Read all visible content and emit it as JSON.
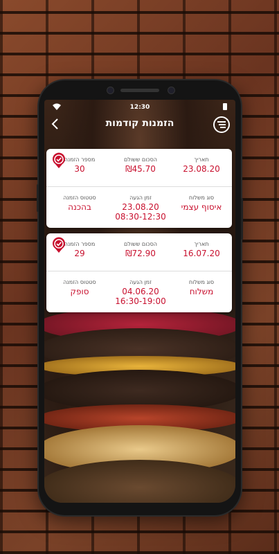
{
  "status_bar": {
    "time": "12:30"
  },
  "header": {
    "title": "הזמנות קודמות"
  },
  "labels": {
    "date": "תאריך",
    "total_paid": "הסכום ששולם",
    "order_number": "מספר הזמנה",
    "delivery_type": "סוג משלוח",
    "arrival_time": "זמן הגעה",
    "order_status": "סטטוס הזמנה"
  },
  "orders": [
    {
      "date": "23.08.20",
      "total": "₪45.70",
      "order_number": "30",
      "delivery_type": "איסוף עצמי",
      "arrival_date": "23.08.20",
      "arrival_window": "08:30-12:30",
      "status": "בהכנה"
    },
    {
      "date": "16.07.20",
      "total": "₪72.90",
      "order_number": "29",
      "delivery_type": "משלוח",
      "arrival_date": "04.06.20",
      "arrival_window": "16:30-19:00",
      "status": "סופק"
    }
  ],
  "colors": {
    "accent": "#c8102e",
    "card_bg": "#ffffff"
  },
  "icons": [
    "wifi-icon",
    "battery-icon",
    "back-icon",
    "menu-icon",
    "check-badge-icon"
  ]
}
